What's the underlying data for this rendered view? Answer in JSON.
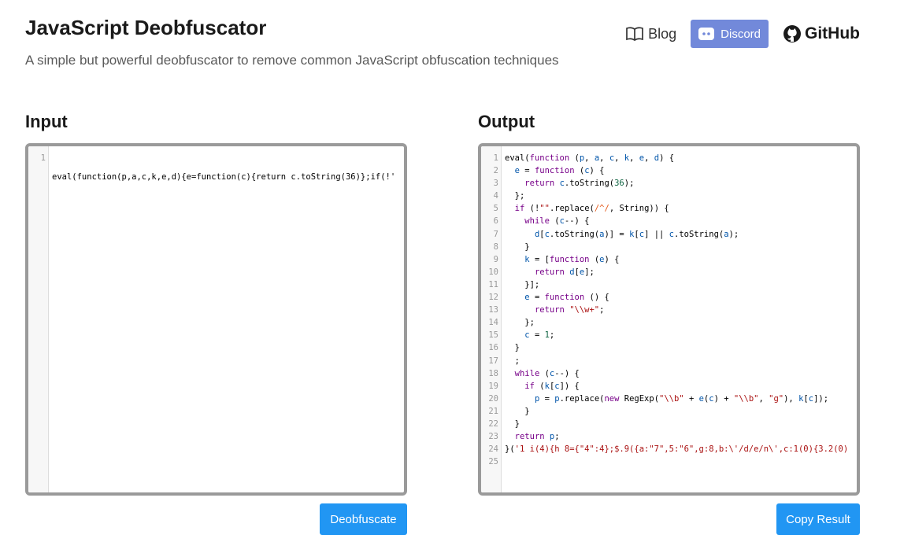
{
  "header": {
    "title": "JavaScript Deobfuscator",
    "subtitle": "A simple but powerful deobfuscator to remove common JavaScript obfuscation techniques"
  },
  "nav": {
    "blog_label": "Blog",
    "discord_label": "Discord",
    "github_label": "GitHub",
    "icons": [
      "book-icon",
      "discord-icon",
      "github-icon"
    ],
    "discord_color": "#7289da"
  },
  "input": {
    "title": "Input",
    "code": "eval(function(p,a,c,k,e,d){e=function(c){return c.toString(36)};if(!'"
  },
  "output": {
    "title": "Output",
    "lines": [
      "eval(function (p, a, c, k, e, d) {",
      "  e = function (c) {",
      "    return c.toString(36);",
      "  };",
      "  if (!\"\".replace(/^/, String)) {",
      "    while (c--) {",
      "      d[c.toString(a)] = k[c] || c.toString(a);",
      "    }",
      "    k = [function (e) {",
      "      return d[e];",
      "    }];",
      "    e = function () {",
      "      return \"\\\\w+\";",
      "    };",
      "    c = 1;",
      "  }",
      "  ;",
      "  while (c--) {",
      "    if (k[c]) {",
      "      p = p.replace(new RegExp(\"\\\\b\" + e(c) + \"\\\\b\", \"g\"), k[c]);",
      "    }",
      "  }",
      "  return p;",
      "}('1 i(4){h 8={\"4\":4};$.9({a:\"7\",5:\"6\",g:8,b:\\'/d/e/n\\',c:1(0){3.2(0)",
      ""
    ]
  },
  "buttons": {
    "deobfuscate_label": "Deobfuscate",
    "copy_label": "Copy Result",
    "color": "#2196f3"
  }
}
